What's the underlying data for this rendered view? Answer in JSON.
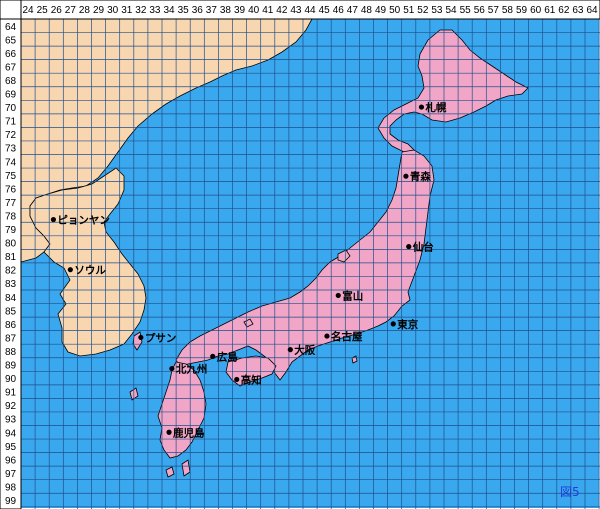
{
  "map": {
    "figure_label": "図5",
    "colors": {
      "sea": "#3aa8ee",
      "japan": "#f2a6c7",
      "mainland": "#f8d6b0",
      "grid": "#1f4f8a",
      "border": "#000000",
      "header": "#ffffff"
    },
    "columns": [
      "24",
      "25",
      "26",
      "27",
      "28",
      "29",
      "30",
      "31",
      "32",
      "33",
      "34",
      "35",
      "36",
      "37",
      "38",
      "39",
      "40",
      "41",
      "42",
      "43",
      "44",
      "45",
      "46",
      "47",
      "48",
      "49",
      "50",
      "51",
      "52",
      "53",
      "54",
      "55",
      "56",
      "57",
      "58",
      "59",
      "60",
      "61",
      "62",
      "63",
      "64"
    ],
    "rows": [
      "64",
      "65",
      "66",
      "67",
      "68",
      "69",
      "70",
      "71",
      "72",
      "73",
      "74",
      "75",
      "76",
      "77",
      "78",
      "79",
      "80",
      "81",
      "82",
      "83",
      "84",
      "85",
      "86",
      "87",
      "88",
      "89",
      "90",
      "91",
      "92",
      "93",
      "94",
      "95",
      "96",
      "97",
      "98",
      "99"
    ],
    "cities": [
      {
        "name": "札幌",
        "col": 51.9,
        "row": 70.0
      },
      {
        "name": "青森",
        "col": 50.8,
        "row": 75.1
      },
      {
        "name": "仙台",
        "col": 51.0,
        "row": 80.3
      },
      {
        "name": "東京",
        "col": 49.9,
        "row": 86.0
      },
      {
        "name": "富山",
        "col": 46.0,
        "row": 83.9
      },
      {
        "name": "名古屋",
        "col": 45.2,
        "row": 86.9
      },
      {
        "name": "大阪",
        "col": 42.6,
        "row": 87.9
      },
      {
        "name": "広島",
        "col": 37.1,
        "row": 88.4
      },
      {
        "name": "高知",
        "col": 38.8,
        "row": 90.1
      },
      {
        "name": "北九州",
        "col": 34.2,
        "row": 89.3
      },
      {
        "name": "鹿児島",
        "col": 34.0,
        "row": 94.0
      },
      {
        "name": "プサン",
        "col": 32.0,
        "row": 87.0
      },
      {
        "name": "ソウル",
        "col": 27.0,
        "row": 82.0
      },
      {
        "name": "ピョンヤン",
        "col": 25.8,
        "row": 78.3
      }
    ]
  }
}
